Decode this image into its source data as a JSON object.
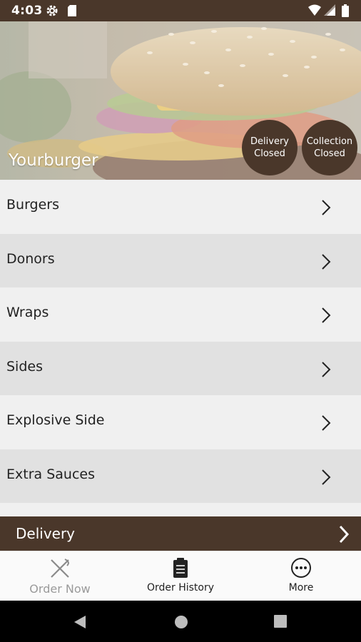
{
  "status_bar": {
    "time": "4:03",
    "icons": [
      "settings-gear-icon",
      "sd-card-icon",
      "wifi-icon",
      "signal-icon",
      "battery-icon"
    ]
  },
  "hero": {
    "restaurant_name": "Yourburger",
    "delivery_status": {
      "line1": "Delivery",
      "line2": "Closed"
    },
    "collection_status": {
      "line1": "Collection",
      "line2": "Closed"
    }
  },
  "menu": {
    "categories": [
      {
        "label": "Burgers"
      },
      {
        "label": "Donors"
      },
      {
        "label": "Wraps"
      },
      {
        "label": "Sides"
      },
      {
        "label": "Explosive Side"
      },
      {
        "label": "Extra Sauces"
      }
    ]
  },
  "delivery_bar": {
    "label": "Delivery"
  },
  "bottom_nav": {
    "items": [
      {
        "label": "Order Now",
        "icon": "fork-knife-icon"
      },
      {
        "label": "Order History",
        "icon": "clipboard-icon"
      },
      {
        "label": "More",
        "icon": "more-dots-icon"
      }
    ]
  },
  "colors": {
    "brand_brown": "#4a372a",
    "list_light": "#f0f0f0",
    "list_dark": "#e1e1e1"
  }
}
